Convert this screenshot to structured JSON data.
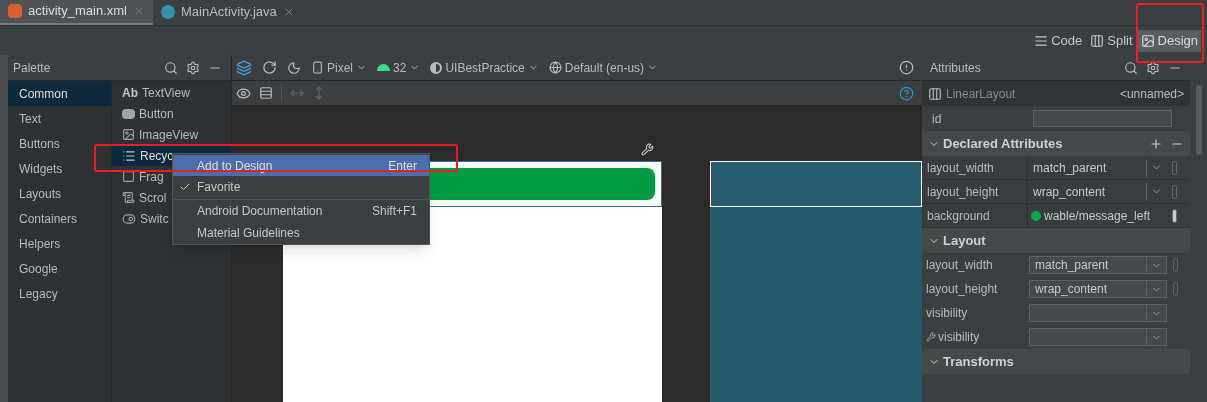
{
  "tabs": [
    {
      "label": "activity_main.xml",
      "kind": "xml",
      "selected": true
    },
    {
      "label": "MainActivity.java",
      "kind": "java",
      "selected": false
    }
  ],
  "view_modes": [
    {
      "label": "Code",
      "kind": "code",
      "selected": false
    },
    {
      "label": "Split",
      "kind": "split",
      "selected": false
    },
    {
      "label": "Design",
      "kind": "design",
      "selected": true
    }
  ],
  "palette": {
    "title": "Palette",
    "categories": [
      {
        "label": "Common",
        "selected": true
      },
      {
        "label": "Text",
        "selected": false
      },
      {
        "label": "Buttons",
        "selected": false
      },
      {
        "label": "Widgets",
        "selected": false
      },
      {
        "label": "Layouts",
        "selected": false
      },
      {
        "label": "Containers",
        "selected": false
      },
      {
        "label": "Helpers",
        "selected": false
      },
      {
        "label": "Google",
        "selected": false
      },
      {
        "label": "Legacy",
        "selected": false
      }
    ],
    "items": [
      {
        "label": "TextView",
        "icon_text": "Ab",
        "kind": "text",
        "selected": false
      },
      {
        "label": "Button",
        "kind": "button",
        "selected": false
      },
      {
        "label": "ImageView",
        "kind": "image",
        "selected": false
      },
      {
        "label": "Recyc",
        "kind": "list",
        "selected": true
      },
      {
        "label": "Frag",
        "kind": "fragment",
        "selected": false
      },
      {
        "label": "Scrol",
        "kind": "scroll",
        "selected": false
      },
      {
        "label": "Switc",
        "kind": "switch",
        "selected": false
      }
    ]
  },
  "toolbar": {
    "device": "Pixel",
    "api_level": "32",
    "theme": "UIBestPractice",
    "locale": "Default (en-us)"
  },
  "context_menu": [
    {
      "label": "Add to Design",
      "shortcut": "Enter",
      "selected": true,
      "checked": false,
      "separator_before": false
    },
    {
      "label": "Favorite",
      "selected": false,
      "checked": true,
      "separator_before": false
    },
    {
      "label": "Android Documentation",
      "shortcut": "Shift+F1",
      "selected": false,
      "checked": false,
      "separator_before": true
    },
    {
      "label": "Material Guidelines",
      "selected": false,
      "checked": false,
      "separator_before": false
    }
  ],
  "attributes": {
    "title": "Attributes",
    "component": "LinearLayout",
    "component_id": "<unnamed>",
    "id_label": "id",
    "sections": [
      {
        "title": "Declared Attributes",
        "expanded": true,
        "kind": "declared",
        "rows": [
          {
            "name": "layout_width",
            "value": "match_parent",
            "kind": "dropdown"
          },
          {
            "name": "layout_height",
            "value": "wrap_content",
            "kind": "dropdown"
          },
          {
            "name": "background",
            "value": "wable/message_left",
            "kind": "resource",
            "color": "#0aa84a"
          }
        ]
      },
      {
        "title": "Layout",
        "expanded": true,
        "kind": "form",
        "rows": [
          {
            "name": "layout_width",
            "value": "match_parent",
            "kind": "dropdown"
          },
          {
            "name": "layout_height",
            "value": "wrap_content",
            "kind": "dropdown"
          },
          {
            "name": "visibility",
            "kind": "dropdown"
          },
          {
            "name": "visibility",
            "kind": "tool_dropdown"
          }
        ]
      },
      {
        "title": "Transforms",
        "expanded": true,
        "kind": "form"
      }
    ]
  }
}
